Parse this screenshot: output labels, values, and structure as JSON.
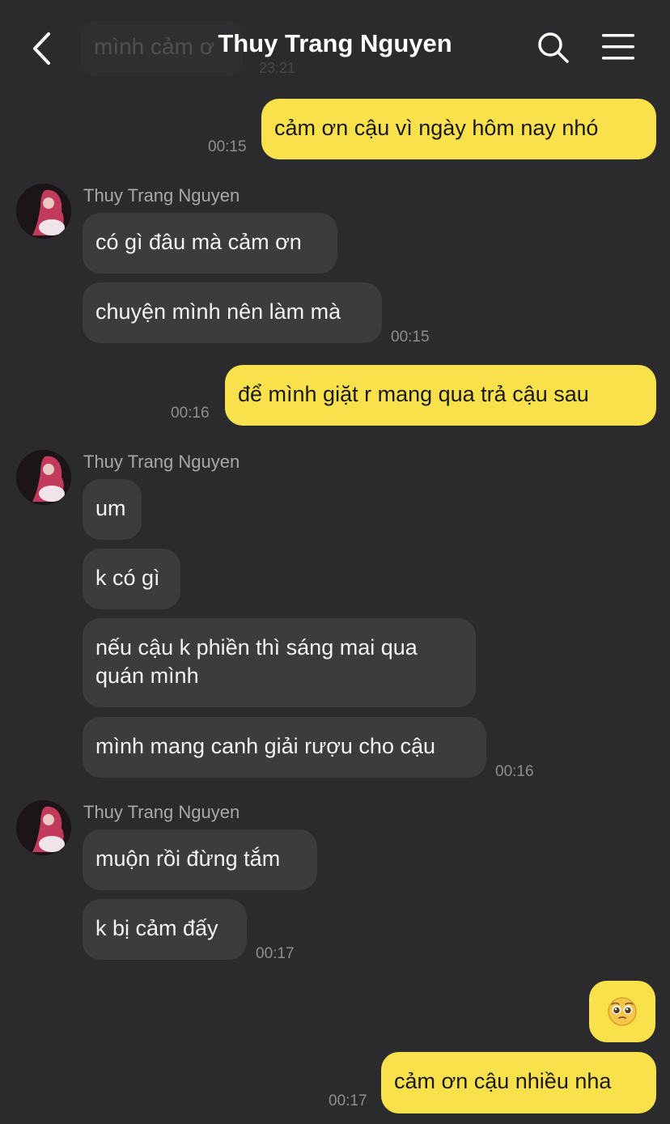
{
  "header": {
    "title": "Thuy Trang Nguyen",
    "ghost_text": "mình cảm ơ",
    "ghost_time": "23:21",
    "back_icon": "chevron-left-icon",
    "search_icon": "search-icon",
    "menu_icon": "hamburger-menu-icon"
  },
  "contact": {
    "name": "Thuy Trang Nguyen"
  },
  "messages": {
    "m1": {
      "text": "cảm ơn cậu vì ngày hôm nay nhó",
      "time": "00:15"
    },
    "m2": {
      "text": "có gì đâu mà cảm ơn"
    },
    "m3": {
      "text": "chuyện mình nên làm mà",
      "time": "00:15"
    },
    "m4": {
      "text": "để mình giặt r mang qua trả cậu sau",
      "time": "00:16"
    },
    "m5": {
      "text": "um"
    },
    "m6": {
      "text": "k có gì"
    },
    "m7": {
      "line1": "nếu cậu k phiền thì sáng mai qua",
      "line2": "quán mình"
    },
    "m8": {
      "text": "mình mang canh giải rượu cho cậu",
      "time": "00:16"
    },
    "m9": {
      "text": "muộn rồi đừng tắm"
    },
    "m10": {
      "text": "k bị cảm đấy",
      "time": "00:17"
    },
    "m11": {
      "emoji": "pleading-face-emoji"
    },
    "m12": {
      "text": "cảm ơn cậu nhiều nha",
      "time": "00:17"
    }
  },
  "colors": {
    "background": "#2b2b2d",
    "incoming_bubble": "#3c3c3f",
    "outgoing_bubble": "#f9e14c",
    "timestamp": "#8e8e92"
  }
}
